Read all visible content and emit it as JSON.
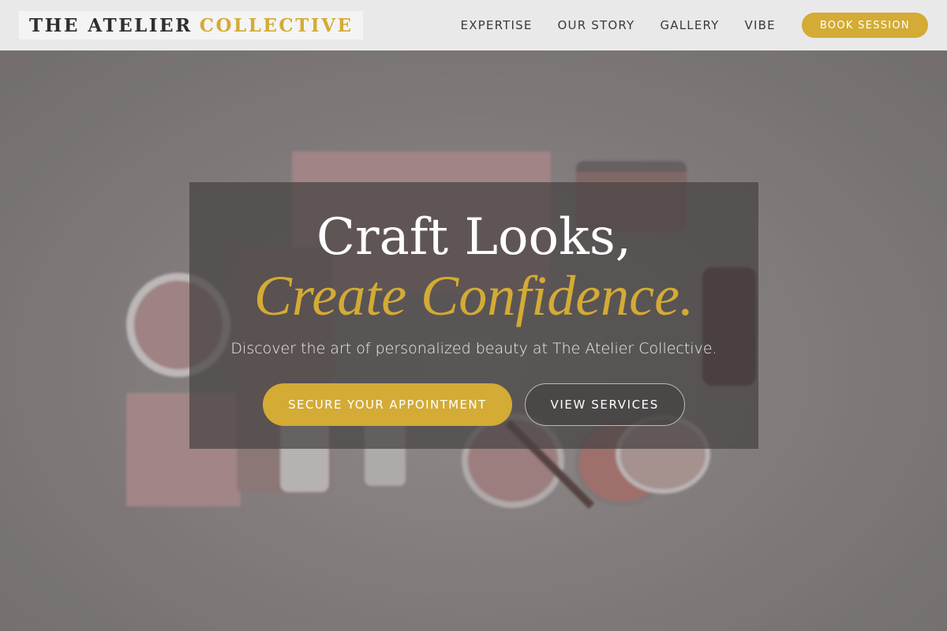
{
  "header": {
    "logo_main": "THE ATELIER",
    "logo_accent": "COLLECTIVE",
    "nav": [
      "EXPERTISE",
      "OUR STORY",
      "GALLERY",
      "VIBE"
    ],
    "book_label": "BOOK SESSION"
  },
  "hero": {
    "title_line1": "Craft Looks,",
    "title_line2": "Create Confidence.",
    "subtitle": "Discover the art of personalized beauty at The Atelier Collective.",
    "primary_cta": "SECURE YOUR APPOINTMENT",
    "secondary_cta": "VIEW SERVICES"
  },
  "colors": {
    "accent": "#d3ab35",
    "header_bg": "#e9e9e9",
    "text_dark": "#2f2f2f"
  }
}
